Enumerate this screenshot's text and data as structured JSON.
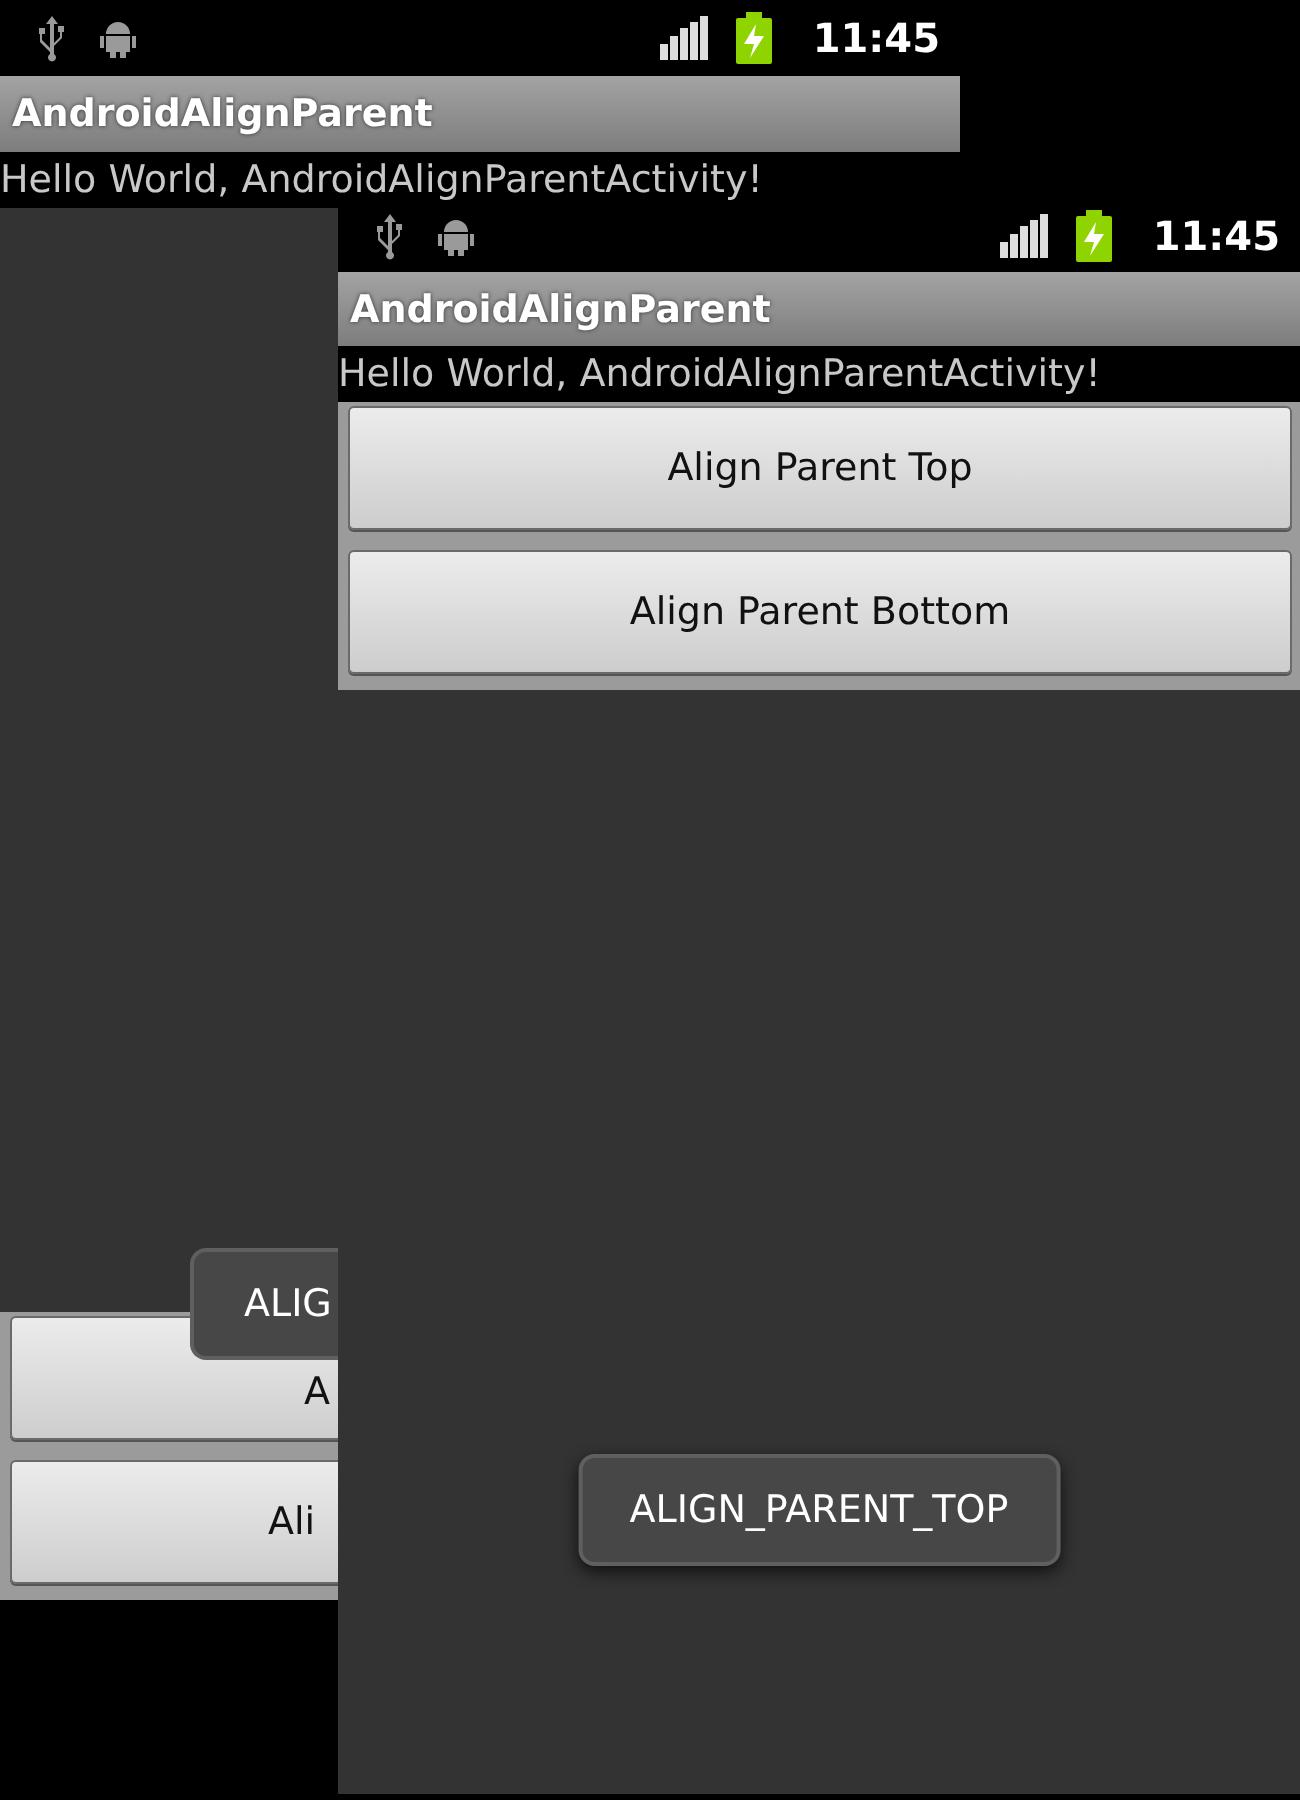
{
  "screens": [
    {
      "kind": "behind",
      "status_bar": {
        "time": "11:45"
      },
      "title": "AndroidAlignParent",
      "message": "Hello World, AndroidAlignParentActivity!",
      "buttons": [
        "A",
        "Ali"
      ],
      "toast": "ALIG"
    },
    {
      "kind": "front",
      "status_bar": {
        "time": "11:45"
      },
      "title": "AndroidAlignParent",
      "message": "Hello World, AndroidAlignParentActivity!",
      "buttons": [
        "Align Parent Top",
        "Align Parent Bottom"
      ],
      "toast": "ALIGN_PARENT_TOP"
    }
  ]
}
